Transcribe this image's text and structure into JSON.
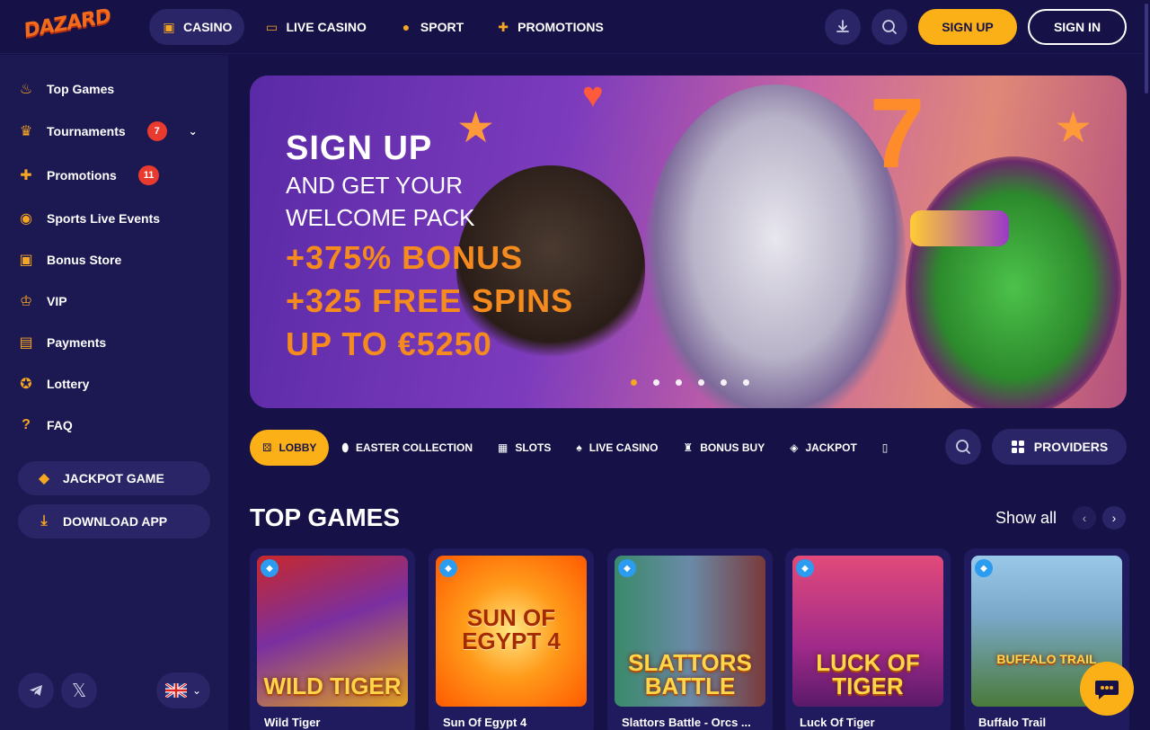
{
  "header": {
    "logo": "DAZARD",
    "nav": [
      {
        "label": "CASINO",
        "icon": "cube-icon"
      },
      {
        "label": "LIVE CASINO",
        "icon": "live-tv-icon"
      },
      {
        "label": "SPORT",
        "icon": "basketball-icon"
      },
      {
        "label": "PROMOTIONS",
        "icon": "gift-icon"
      }
    ],
    "signup_label": "SIGN UP",
    "signin_label": "SIGN IN"
  },
  "sidebar": {
    "items": [
      {
        "label": "Top Games",
        "icon": "flame-icon"
      },
      {
        "label": "Tournaments",
        "icon": "trophy-icon",
        "badge": "7"
      },
      {
        "label": "Promotions",
        "icon": "gift-icon",
        "badge": "11"
      },
      {
        "label": "Sports Live Events",
        "icon": "broadcast-icon"
      },
      {
        "label": "Bonus Store",
        "icon": "shopping-bag-icon"
      },
      {
        "label": "VIP",
        "icon": "crown-icon"
      },
      {
        "label": "Payments",
        "icon": "card-icon"
      },
      {
        "label": "Lottery",
        "icon": "lottery-ball-icon"
      },
      {
        "label": "FAQ",
        "icon": "question-icon"
      }
    ],
    "jackpot_label": "JACKPOT GAME",
    "download_label": "DOWNLOAD APP"
  },
  "banner": {
    "line1": "SIGN UP",
    "line2": "AND GET YOUR",
    "line3": "WELCOME PACK",
    "line4": "+375% BONUS",
    "line5": "+325 FREE SPINS",
    "line6": "UP TO €5250",
    "slides": 6,
    "active_slide": 1
  },
  "categories": [
    {
      "label": "LOBBY",
      "icon": "dice-icon",
      "active": true
    },
    {
      "label": "EASTER COLLECTION",
      "icon": "egg-icon"
    },
    {
      "label": "SLOTS",
      "icon": "slot-icon"
    },
    {
      "label": "LIVE CASINO",
      "icon": "spade-icon"
    },
    {
      "label": "BONUS BUY",
      "icon": "bonus-icon"
    },
    {
      "label": "JACKPOT",
      "icon": "diamond-icon"
    }
  ],
  "providers_label": "PROVIDERS",
  "section": {
    "title": "TOP GAMES",
    "show_all": "Show all"
  },
  "games": [
    {
      "name": "Wild Tiger",
      "art": "WILD TIGER",
      "color1": "#7a2fa0",
      "color2": "#e0a020"
    },
    {
      "name": "Sun Of Egypt 4",
      "art": "SUN OF EGYPT 4",
      "color1": "#ff9a1a",
      "color2": "#ff5a00"
    },
    {
      "name": "Slattors Battle - Orcs ...",
      "art": "SLATTORS BATTLE",
      "color1": "#3a6b8a",
      "color2": "#2a2a3a"
    },
    {
      "name": "Luck Of Tiger",
      "art": "LUCK OF TIGER",
      "color1": "#e24a7a",
      "color2": "#7a2a9a"
    },
    {
      "name": "Buffalo Trail",
      "art": "BUFFALO TRAIL",
      "color1": "#7aa8c8",
      "color2": "#4a7a3a"
    }
  ]
}
